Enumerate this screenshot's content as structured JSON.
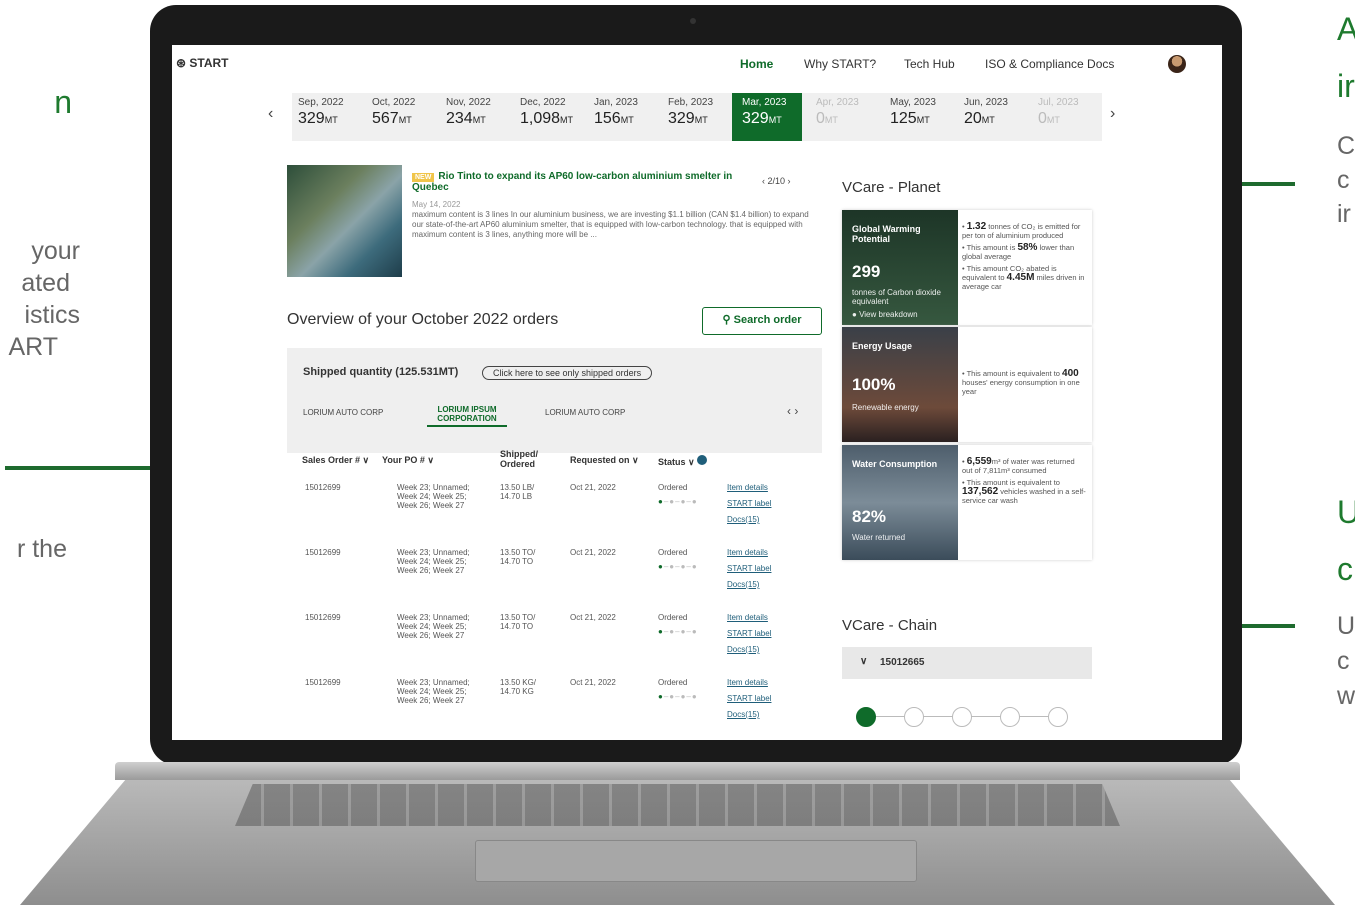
{
  "annotations": {
    "left_lines": [
      "n",
      "your",
      "ated",
      "istics",
      "ART",
      "",
      "r the"
    ],
    "right_top_title": [
      "A",
      "ir"
    ],
    "right_top_desc": [
      "C",
      "c",
      "ir"
    ],
    "right_bottom_title": [
      "U",
      "c"
    ],
    "right_bottom_desc": [
      "U",
      "c",
      "w"
    ]
  },
  "nav": {
    "logo": "START",
    "items": [
      "Home",
      "Why START?",
      "Tech Hub",
      "ISO & Compliance Docs"
    ],
    "active": "Home"
  },
  "months": [
    {
      "label": "Sep, 2022",
      "value": "329",
      "unit": "MT"
    },
    {
      "label": "Oct, 2022",
      "value": "567",
      "unit": "MT"
    },
    {
      "label": "Nov, 2022",
      "value": "234",
      "unit": "MT"
    },
    {
      "label": "Dec, 2022",
      "value": "1,098",
      "unit": "MT"
    },
    {
      "label": "Jan, 2023",
      "value": "156",
      "unit": "MT"
    },
    {
      "label": "Feb, 2023",
      "value": "329",
      "unit": "MT"
    },
    {
      "label": "Mar, 2023",
      "value": "329",
      "unit": "MT",
      "selected": true
    },
    {
      "label": "Apr, 2023",
      "value": "0",
      "unit": "MT",
      "dim": true
    },
    {
      "label": "May, 2023",
      "value": "125",
      "unit": "MT"
    },
    {
      "label": "Jun, 2023",
      "value": "20",
      "unit": "MT"
    },
    {
      "label": "Jul, 2023",
      "value": "0",
      "unit": "MT",
      "dim": true
    }
  ],
  "news": {
    "tag": "NEW",
    "title": "Rio Tinto to expand its AP60 low-carbon aluminium smelter in Quebec",
    "date": "May 14, 2022",
    "body": "maximum content is 3 lines In our aluminium business, we are investing $1.1 billion (CAN $1.4 billion) to expand our state-of-the-art AP60 aluminium smelter, that is equipped with low-carbon technology. that is equipped with maximum content is 3 lines, anything more will be ...",
    "pager": "2/10"
  },
  "overview": {
    "title": "Overview of your October 2022 orders",
    "search_label": "Search order",
    "shipped_label": "Shipped quantity (125.531MT)",
    "shipped_filter": "Click here to see only shipped orders",
    "tabs": [
      "LORIUM AUTO CORP",
      "LORIUM IPSUM CORPORATION",
      "LORIUM AUTO CORP"
    ],
    "columns": [
      "Sales Order #",
      "Your PO #",
      "Shipped/ Ordered",
      "Requested on",
      "Status"
    ],
    "rows": [
      {
        "so": "15012699",
        "po": "Week 23; Unnamed; Week 24; Week 25; Week 26; Week 27",
        "qty": "13.50 LB/ 14.70 LB",
        "req": "Oct 21, 2022",
        "status": "Ordered"
      },
      {
        "so": "15012699",
        "po": "Week 23; Unnamed; Week 24; Week 25; Week 26; Week 27",
        "qty": "13.50 TO/ 14.70 TO",
        "req": "Oct 21, 2022",
        "status": "Ordered"
      },
      {
        "so": "15012699",
        "po": "Week 23; Unnamed; Week 24; Week 25; Week 26; Week 27",
        "qty": "13.50 TO/ 14.70 TO",
        "req": "Oct 21, 2022",
        "status": "Ordered"
      },
      {
        "so": "15012699",
        "po": "Week 23; Unnamed; Week 24; Week 25; Week 26; Week 27",
        "qty": "13.50 KG/ 14.70 KG",
        "req": "Oct 21, 2022",
        "status": "Ordered"
      }
    ],
    "row_links": [
      "Item details",
      "START label",
      "Docs(15)"
    ]
  },
  "vcare_planet": {
    "title": "VCare - Planet",
    "cards": [
      {
        "heading": "Global Warming Potential",
        "big": "299",
        "sub": "tonnes of Carbon dioxide equivalent",
        "link": "View breakdown",
        "points": [
          "1.32 tonnes of CO₂ is emitted for per ton of aluminium produced",
          "This amount is 58% lower than global average",
          "This amount CO₂ abated is equivalent to 4.45M miles driven in average car"
        ]
      },
      {
        "heading": "Energy Usage",
        "big": "100%",
        "sub": "Renewable energy",
        "points": [
          "This amount is equivalent to 400 houses' energy consumption in one year"
        ]
      },
      {
        "heading": "Water Consumption",
        "big": "82%",
        "sub": "Water returned",
        "points": [
          "6,559m³ of water was returned out of 7,811m³ consumed",
          "This amount is equivalent to 137,562 vehicles washed in a self-service car wash"
        ]
      }
    ]
  },
  "vcare_chain": {
    "title": "VCare - Chain",
    "order": "15012665"
  },
  "colors": {
    "brand": "#0f6b2a",
    "annotation": "#1e7a2e"
  }
}
